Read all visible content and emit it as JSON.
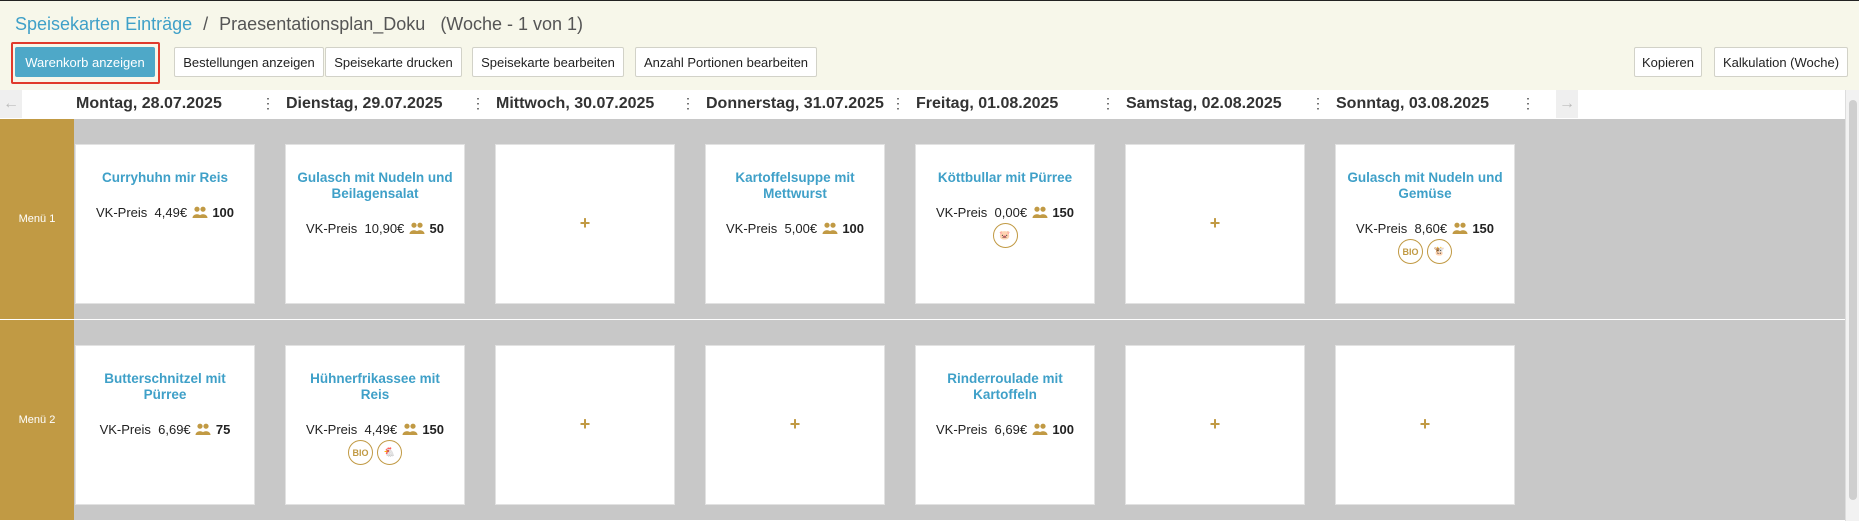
{
  "breadcrumb": {
    "root": "Speisekarten Einträge",
    "separator": "/",
    "plan": "Praesentationsplan_Doku",
    "week": "(Woche - 1 von 1)"
  },
  "toolbar": {
    "show_cart": "Warenkorb anzeigen",
    "show_orders": "Bestellungen anzeigen",
    "print_menu": "Speisekarte drucken",
    "edit_menu": "Speisekarte bearbeiten",
    "edit_portions": "Anzahl Portionen bearbeiten",
    "copy": "Kopieren",
    "calculation": "Kalkulation (Woche)"
  },
  "nav": {
    "prev_icon": "arrow-left-icon",
    "next_icon": "arrow-right-icon"
  },
  "days": [
    "Montag, 28.07.2025",
    "Dienstag, 29.07.2025",
    "Mittwoch, 30.07.2025",
    "Donnerstag, 31.07.2025",
    "Freitag, 01.08.2025",
    "Samstag, 02.08.2025",
    "Sonntag, 03.08.2025"
  ],
  "day_menu_glyph": "⋮",
  "price_label": "VK-Preis",
  "add_glyph": "+",
  "rows": [
    {
      "label": "Menü 1",
      "cells": [
        {
          "title": "Curryhuhn mir Reis",
          "price": "4,49€",
          "portions": "100",
          "badges": []
        },
        {
          "title": "Gulasch mit Nudeln und Beilagensalat",
          "price": "10,90€",
          "portions": "50",
          "badges": []
        },
        null,
        {
          "title": "Kartoffelsuppe mit Mettwurst",
          "price": "5,00€",
          "portions": "100",
          "badges": []
        },
        {
          "title": "Köttbullar mit Pürree",
          "price": "0,00€",
          "portions": "150",
          "badges": [
            "pig-icon"
          ]
        },
        null,
        {
          "title": "Gulasch mit Nudeln und Gemüse",
          "price": "8,60€",
          "portions": "150",
          "badges": [
            "bio-icon",
            "cow-icon"
          ]
        }
      ]
    },
    {
      "label": "Menü 2",
      "cells": [
        {
          "title": "Butterschnitzel mit Pürree",
          "price": "6,69€",
          "portions": "75",
          "badges": []
        },
        {
          "title": "Hühnerfrikassee mit Reis",
          "price": "4,49€",
          "portions": "150",
          "badges": [
            "bio-icon",
            "chicken-icon"
          ]
        },
        null,
        null,
        {
          "title": "Rinderroulade mit Kartoffeln",
          "price": "6,69€",
          "portions": "100",
          "badges": []
        },
        null,
        null
      ]
    }
  ],
  "badge_text": {
    "bio-icon": "BIO",
    "pig-icon": "🐷",
    "cow-icon": "🐮",
    "chicken-icon": "🐔"
  },
  "colors": {
    "accent": "#3fa0c8",
    "primary_button": "#4ea8c8",
    "row_label": "#c19a44",
    "highlight": "#e03a2c"
  }
}
